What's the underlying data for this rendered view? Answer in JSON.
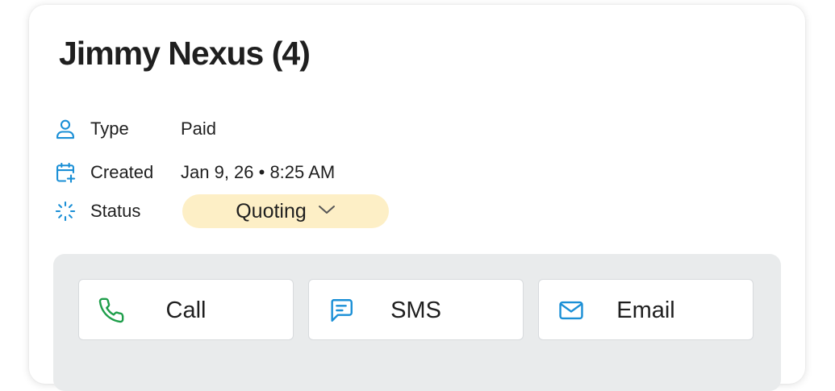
{
  "header": {
    "title": "Jimmy Nexus (4)"
  },
  "details": {
    "type": {
      "label": "Type",
      "value": "Paid",
      "icon": "user-icon"
    },
    "created": {
      "label": "Created",
      "value": "Jan 9, 26 • 8:25 AM",
      "icon": "calendar-plus-icon"
    },
    "status": {
      "label": "Status",
      "value": "Quoting",
      "icon": "loader-icon"
    }
  },
  "actions": {
    "call": {
      "label": "Call",
      "icon": "phone-icon"
    },
    "sms": {
      "label": "SMS",
      "icon": "message-icon"
    },
    "email": {
      "label": "Email",
      "icon": "mail-icon"
    }
  },
  "colors": {
    "accent_blue": "#1a8fd6",
    "call_green": "#1e9e4a",
    "status_pill_bg": "#fdefc6",
    "actions_panel_bg": "#e9ebec",
    "text": "#1f1f1f"
  }
}
